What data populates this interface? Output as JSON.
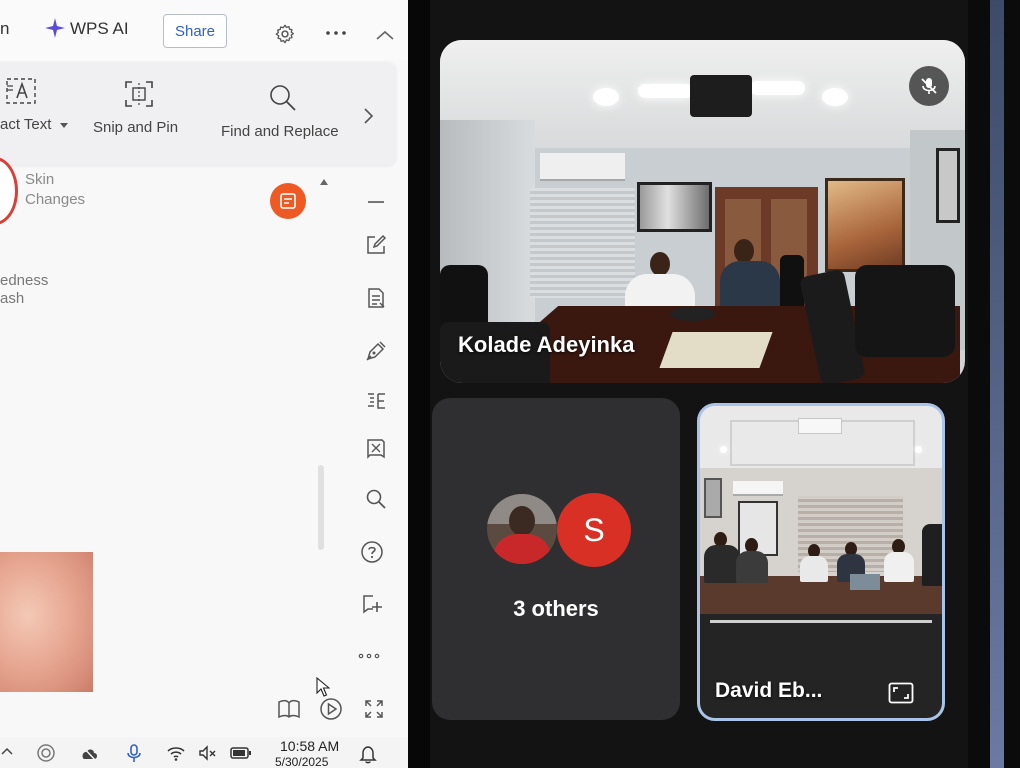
{
  "wps": {
    "left_partial": "n",
    "ai_label": "WPS AI",
    "share_label": "Share",
    "toolbar": {
      "extract_text_label": "act Text",
      "snip_label": "Snip and Pin",
      "find_replace_label": "Find and Replace"
    },
    "doc": {
      "card_line1": "Skin",
      "card_line2": "Changes",
      "partial_line1": "edness",
      "partial_line2": "ash"
    }
  },
  "taskbar": {
    "time": "10:58 AM",
    "date": "5/30/2025"
  },
  "meet": {
    "main_participant": "Kolade Adeyinka",
    "others_avatar_letter": "S",
    "others_label": "3 others",
    "side_participant": "David Eb..."
  },
  "icons": {
    "header": [
      "sparkle-icon",
      "gear-icon",
      "more-icon",
      "chevron-up-icon"
    ],
    "toolbar": [
      "extract-text-icon",
      "snip-icon",
      "search-icon",
      "chevron-right-icon"
    ],
    "sidebar": [
      "collapse-icon",
      "edit-icon",
      "document-icon",
      "pen-icon",
      "outline-icon",
      "book-icon",
      "search-icon",
      "help-icon",
      "book-plus-icon",
      "more-icon"
    ],
    "footer": [
      "read-mode-icon",
      "play-icon",
      "fullscreen-icon"
    ],
    "tray": [
      "tray-up-icon",
      "app-icon",
      "cloud-icon",
      "mic-icon",
      "wifi-icon",
      "volume-mute-icon",
      "battery-icon",
      "bell-icon"
    ],
    "meet": [
      "mic-off-icon",
      "expand-icon"
    ]
  },
  "colors": {
    "ai_purple": "#5b4bdb",
    "share_blue": "#2f62c4",
    "accent_orange": "#ee5a24",
    "avatar_red": "#d93025",
    "speaking_border": "#a9c4e8",
    "meet_background": "#131313",
    "tile_gray": "#2f2f31"
  }
}
